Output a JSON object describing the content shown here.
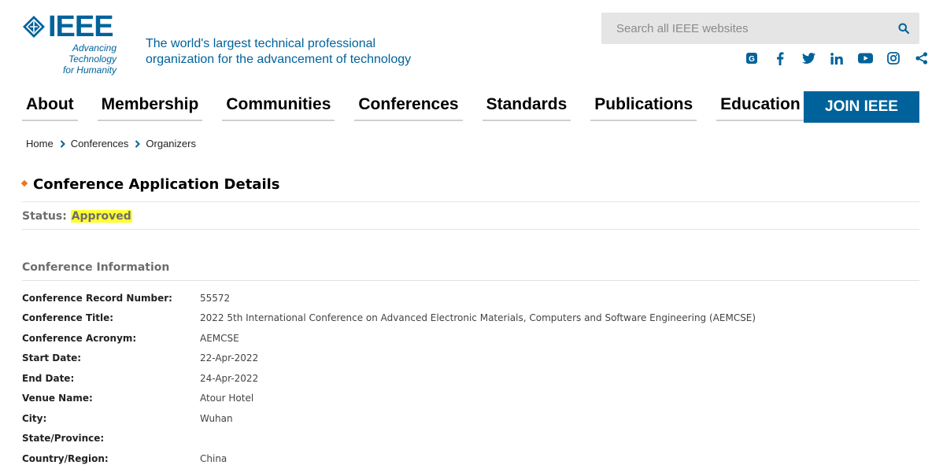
{
  "header": {
    "logo_word": "IEEE",
    "logo_sub_line1": "Advancing Technology",
    "logo_sub_line2": "for Humanity",
    "tagline_line1": "The world's largest technical professional",
    "tagline_line2": "organization for the advancement of technology",
    "search_placeholder": "Search all IEEE websites",
    "brand_color": "#00629b",
    "social_icons": [
      "ieee-collabratec-icon",
      "facebook-icon",
      "twitter-icon",
      "linkedin-icon",
      "youtube-icon",
      "instagram-icon",
      "share-icon"
    ]
  },
  "nav": {
    "items": [
      "About",
      "Membership",
      "Communities",
      "Conferences",
      "Standards",
      "Publications",
      "Education"
    ],
    "join_label": "JOIN IEEE"
  },
  "breadcrumb": [
    "Home",
    "Conferences",
    "Organizers"
  ],
  "page": {
    "title": "Conference Application Details",
    "status_label": "Status:",
    "status_value": "Approved",
    "section_title": "Conference Information"
  },
  "conference": [
    {
      "label": "Conference Record Number:",
      "value": "55572"
    },
    {
      "label": "Conference Title:",
      "value": "2022 5th International Conference on Advanced Electronic Materials, Computers and Software Engineering (AEMCSE)"
    },
    {
      "label": "Conference Acronym:",
      "value": "AEMCSE"
    },
    {
      "label": "Start Date:",
      "value": "22-Apr-2022"
    },
    {
      "label": "End Date:",
      "value": "24-Apr-2022"
    },
    {
      "label": "Venue Name:",
      "value": "Atour Hotel"
    },
    {
      "label": "City:",
      "value": "Wuhan"
    },
    {
      "label": "State/Province:",
      "value": ""
    },
    {
      "label": "Country/Region:",
      "value": "China"
    }
  ]
}
